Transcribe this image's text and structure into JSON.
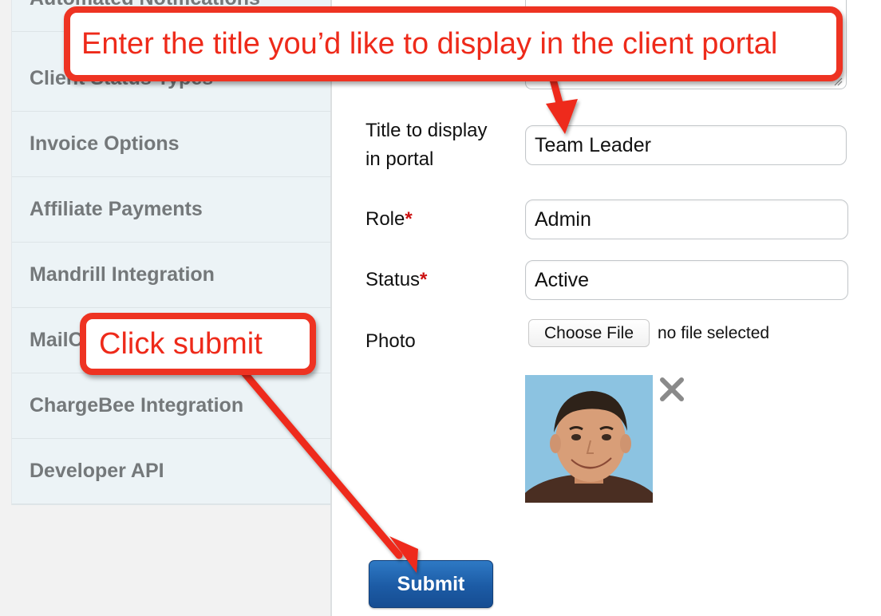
{
  "sidebar": {
    "items": [
      {
        "label": "Automated Notifications"
      },
      {
        "label": "Client Status Types"
      },
      {
        "label": "Invoice Options"
      },
      {
        "label": "Affiliate Payments"
      },
      {
        "label": "Mandrill Integration"
      },
      {
        "label": "MailChimp Integration"
      },
      {
        "label": "ChargeBee Integration"
      },
      {
        "label": "Developer API"
      }
    ]
  },
  "form": {
    "title_label_line1": "Title to display",
    "title_label_line2": "in portal",
    "title_value": "Team Leader",
    "role_label": "Role",
    "role_value": "Admin",
    "status_label": "Status",
    "status_value": "Active",
    "required_mark": "*",
    "photo_label": "Photo",
    "file_button_label": "Choose File",
    "file_status": "no file selected",
    "submit_label": "Submit"
  },
  "callouts": {
    "top": "Enter the title you’d like to display in the client portal",
    "bottom": "Click submit"
  },
  "icons": {
    "remove_photo": "close-icon",
    "resize": "resize-grip-icon"
  },
  "colors": {
    "callout": "#ee3322",
    "submit": "#1c5ba5",
    "required": "#cc1111"
  }
}
